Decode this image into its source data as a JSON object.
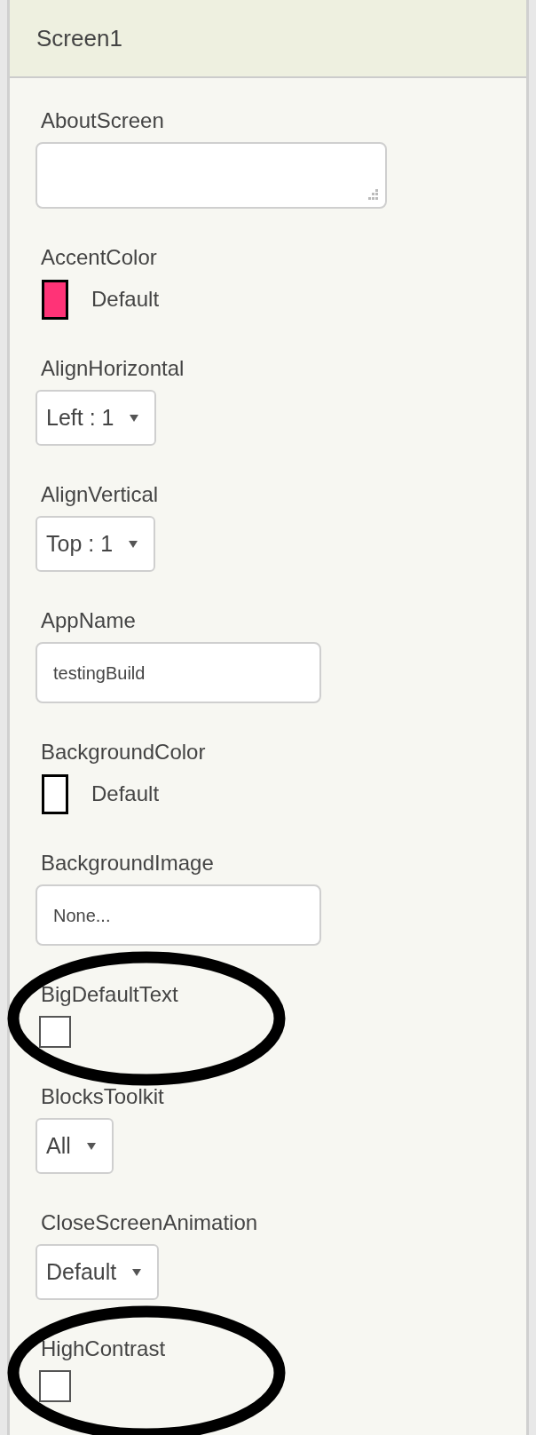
{
  "header": {
    "title": "Screen1"
  },
  "properties": [
    {
      "label": "AboutScreen",
      "kind": "textarea",
      "circled": false
    },
    {
      "label": "AccentColor",
      "kind": "color",
      "color": "#ff3377",
      "value": "Default",
      "circled": false
    },
    {
      "label": "AlignHorizontal",
      "kind": "dropdown",
      "value": "Left : 1",
      "circled": false
    },
    {
      "label": "AlignVertical",
      "kind": "dropdown",
      "value": "Top : 1",
      "circled": false
    },
    {
      "label": "AppName",
      "kind": "text",
      "value": "testingBuild",
      "circled": false
    },
    {
      "label": "BackgroundColor",
      "kind": "color",
      "color": "#ffffff",
      "value": "Default",
      "circled": false
    },
    {
      "label": "BackgroundImage",
      "kind": "text",
      "value": "None...",
      "circled": false
    },
    {
      "label": "BigDefaultText",
      "kind": "checkbox",
      "checked": false,
      "circled": true
    },
    {
      "label": "BlocksToolkit",
      "kind": "dropdown",
      "value": "All",
      "circled": false
    },
    {
      "label": "CloseScreenAnimation",
      "kind": "dropdown",
      "value": "Default",
      "circled": false
    },
    {
      "label": "HighContrast",
      "kind": "checkbox",
      "checked": false,
      "circled": true
    }
  ]
}
